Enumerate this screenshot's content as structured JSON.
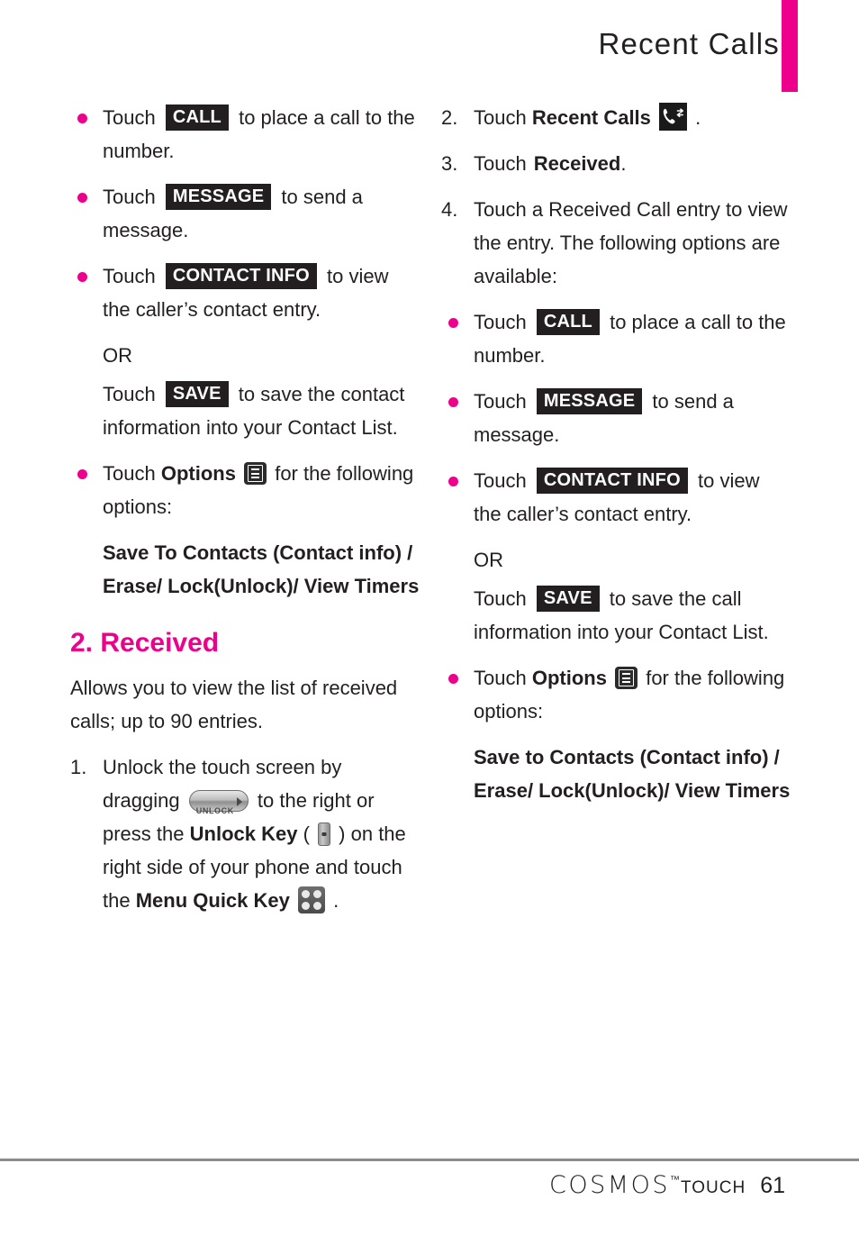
{
  "header": {
    "title": "Recent Calls",
    "accent_color": "#ec008c"
  },
  "colors": {
    "accent": "#ec008c",
    "text": "#231f20",
    "keycap_bg": "#231f20",
    "keycap_text": "#ffffff",
    "footer_rule": "#8c8c8c"
  },
  "left_column": {
    "bullets": [
      {
        "pre": "Touch",
        "keycap": "CALL",
        "post": "to place a call to the number."
      },
      {
        "pre": "Touch",
        "keycap": "MESSAGE",
        "post": "to send a message."
      },
      {
        "pre": "Touch",
        "keycap": "CONTACT INFO",
        "post": "to view the caller’s contact entry."
      }
    ],
    "or_label": "OR",
    "save_line": {
      "pre": "Touch",
      "keycap": "SAVE",
      "post": "to save the contact information into your Contact List."
    },
    "options_bullet": {
      "pre": "Touch",
      "bold": "Options",
      "icon": "options-menu-icon",
      "post": "for the following options:"
    },
    "options_list": "Save To Contacts (Contact info) / Erase/ Lock(Unlock)/ View Timers",
    "section_heading": "2. Received",
    "section_intro": "Allows you to view the list of received calls; up to 90 entries.",
    "step1": {
      "marker": "1.",
      "part1": "Unlock the touch screen by dragging",
      "icon1": "unlock-slider-icon",
      "icon1_label": "UNLOCK",
      "part2": "to the right or press the",
      "bold1": "Unlock Key",
      "paren_open": "(",
      "icon2": "unlock-side-key-icon",
      "paren_close": ")",
      "part3": "on the right side of your phone and touch the",
      "bold2": "Menu Quick Key",
      "icon3": "menu-quick-key-icon",
      "part4": "."
    }
  },
  "right_column": {
    "step2": {
      "marker": "2.",
      "pre": "Touch",
      "bold": "Recent Calls",
      "icon": "recent-calls-icon",
      "post": "."
    },
    "step3": {
      "marker": "3.",
      "pre": "Touch",
      "bold": "Received",
      "post": "."
    },
    "step4": {
      "marker": "4.",
      "text": "Touch a Received Call entry to view the entry. The following options are available:"
    },
    "bullets": [
      {
        "pre": "Touch",
        "keycap": "CALL",
        "post": "to place a call to the number."
      },
      {
        "pre": "Touch",
        "keycap": "MESSAGE",
        "post": "to send a message."
      },
      {
        "pre": "Touch",
        "keycap": "CONTACT INFO",
        "post": "to view the caller’s contact entry."
      }
    ],
    "or_label": "OR",
    "save_line": {
      "pre": "Touch",
      "keycap": "SAVE",
      "post": "to save the call information into your Contact List."
    },
    "options_bullet": {
      "pre": "Touch",
      "bold": "Options",
      "icon": "options-menu-icon",
      "post": "for the following options:"
    },
    "options_list": "Save to Contacts (Contact info) / Erase/ Lock(Unlock)/ View Timers"
  },
  "footer": {
    "brand": "COSMOS",
    "trademark": "™",
    "sub_brand": "TOUCH",
    "page_number": "61"
  }
}
